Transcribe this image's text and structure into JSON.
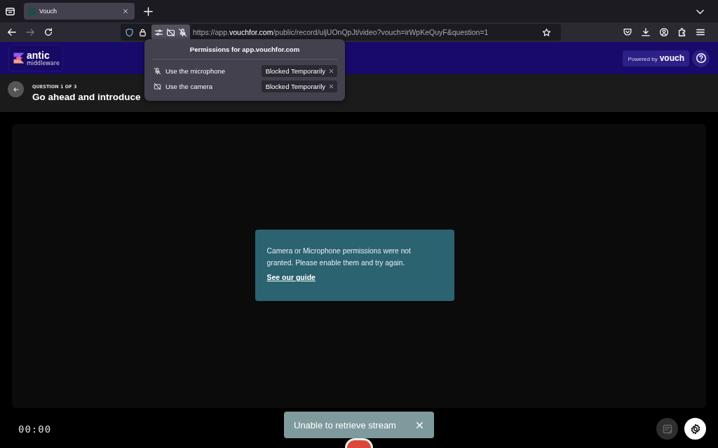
{
  "browser": {
    "tab": {
      "title": "Vouch",
      "selected": true
    },
    "forward_disabled": true,
    "url": {
      "prefix": "https://app.",
      "domain": "vouchfor.com",
      "path": "/public/record/uljUOnQpJt/video?vouch=irWpKeQuyF&question=1"
    }
  },
  "permissions_popup": {
    "title": "Permissions for app.vouchfor.com",
    "items": [
      {
        "kind": "microphone",
        "label": "Use the microphone",
        "status": "Blocked Temporarily"
      },
      {
        "kind": "camera",
        "label": "Use the camera",
        "status": "Blocked Temporarily"
      }
    ]
  },
  "header": {
    "logo": {
      "name": "antic",
      "tagline": "middleware"
    },
    "powered_by": {
      "label": "Powered by",
      "brand": "vouch"
    }
  },
  "question": {
    "counter": "QUESTION 1 OF 3",
    "title": "Go ahead and introduce"
  },
  "alert": {
    "message": "Camera or Microphone permissions were not granted. Please enable them and try again.",
    "link": "See our guide"
  },
  "timer": "00:00",
  "toast": {
    "message": "Unable to retrieve stream"
  }
}
